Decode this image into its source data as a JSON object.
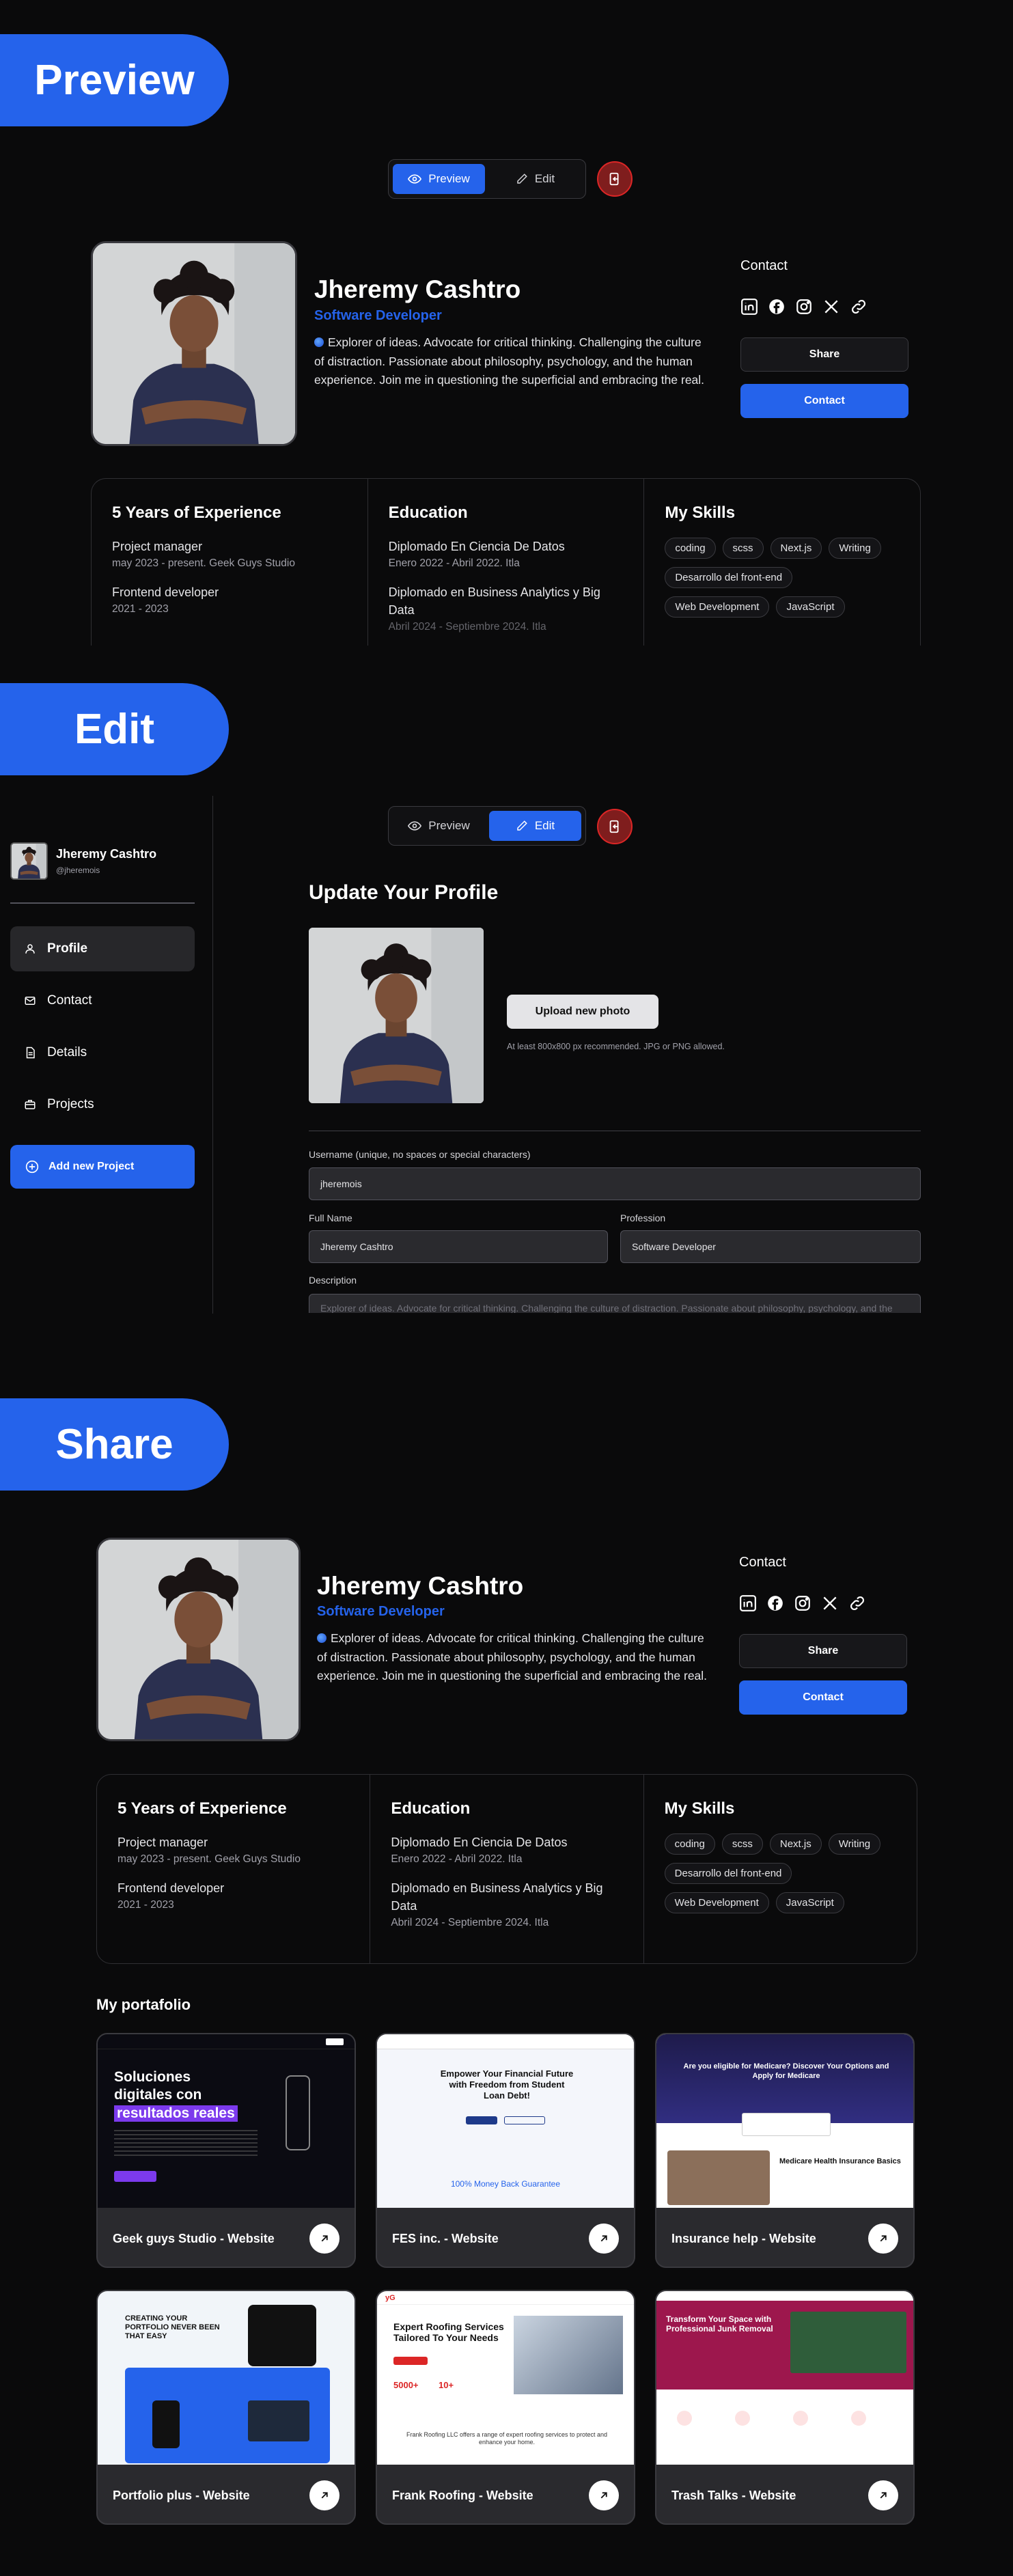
{
  "banners": {
    "preview": "Preview",
    "edit": "Edit",
    "share": "Share"
  },
  "toggle": {
    "preview_label": "Preview",
    "edit_label": "Edit"
  },
  "profile": {
    "name": "Jheremy Cashtro",
    "role": "Software Developer",
    "bio": "Explorer of ideas. Advocate for critical thinking. Challenging the culture of distraction. Passionate about philosophy, psychology, and the human experience. Join me in questioning the superficial and embracing the real.",
    "contact_label": "Contact",
    "share_button": "Share",
    "contact_button": "Contact",
    "socials": [
      "linkedin-icon",
      "facebook-icon",
      "instagram-icon",
      "x-icon",
      "link-icon"
    ]
  },
  "stats": {
    "experience": {
      "title": "5 Years of Experience",
      "items": [
        {
          "title": "Project manager",
          "sub": "may 2023 - present. Geek Guys Studio"
        },
        {
          "title": "Frontend developer",
          "sub": "2021 - 2023"
        }
      ]
    },
    "education": {
      "title": "Education",
      "items": [
        {
          "title": "Diplomado En Ciencia De Datos",
          "sub": "Enero 2022 - Abril 2022. Itla"
        },
        {
          "title": "Diplomado en Business Analytics y Big Data",
          "sub": "Abril 2024 - Septiembre 2024. Itla"
        }
      ]
    },
    "skills": {
      "title": "My Skills",
      "items": [
        "coding",
        "scss",
        "Next.js",
        "Writing",
        "Desarrollo del front-end",
        "Web Development",
        "JavaScript"
      ]
    }
  },
  "sidebar": {
    "user_name": "Jheremy Cashtro",
    "user_handle": "@jheremois",
    "items": [
      {
        "label": "Profile",
        "icon": "user-icon"
      },
      {
        "label": "Contact",
        "icon": "mail-icon"
      },
      {
        "label": "Details",
        "icon": "document-icon"
      },
      {
        "label": "Projects",
        "icon": "briefcase-icon"
      }
    ],
    "add_project": "Add new Project"
  },
  "edit": {
    "title": "Update Your Profile",
    "upload_button": "Upload new photo",
    "upload_hint": "At least 800x800 px recommended. JPG or PNG allowed.",
    "username_label": "Username (unique, no spaces or special characters)",
    "username_value": "jheremois",
    "fullname_label": "Full Name",
    "fullname_value": "Jheremy Cashtro",
    "profession_label": "Profession",
    "profession_value": "Software Developer",
    "description_label": "Description",
    "description_value": "Explorer of ideas. Advocate for critical thinking. Challenging the culture of distraction. Passionate about philosophy, psychology, and the"
  },
  "portfolio": {
    "title": "My portafolio",
    "projects": [
      {
        "title": "Geek guys Studio - Website",
        "heading": "Soluciones digitales con",
        "highlight": "resultados reales"
      },
      {
        "title": "FES inc. - Website",
        "heading": "Empower Your Financial Future with Freedom from Student Loan Debt!",
        "sub": "100% Money Back Guarantee"
      },
      {
        "title": "Insurance help - Website",
        "heading": "Are you eligible for Medicare? Discover Your Options and Apply for Medicare",
        "sub": "Medicare Health Insurance Basics"
      },
      {
        "title": "Portfolio plus - Website",
        "heading": "CREATING YOUR PORTFOLIO NEVER BEEN THAT EASY"
      },
      {
        "title": "Frank Roofing - Website",
        "heading": "Expert Roofing Services Tailored To Your Needs",
        "sub": "Frank Roofing LLC offers a range of expert roofing services to protect and enhance your home.",
        "stat1": "5000+",
        "stat2": "10+"
      },
      {
        "title": "Trash Talks - Website",
        "heading": "Transform Your Space with Professional Junk Removal"
      }
    ]
  },
  "colors": {
    "accent": "#2563eb",
    "background": "#0a0a0b",
    "danger": "#dc2626"
  }
}
